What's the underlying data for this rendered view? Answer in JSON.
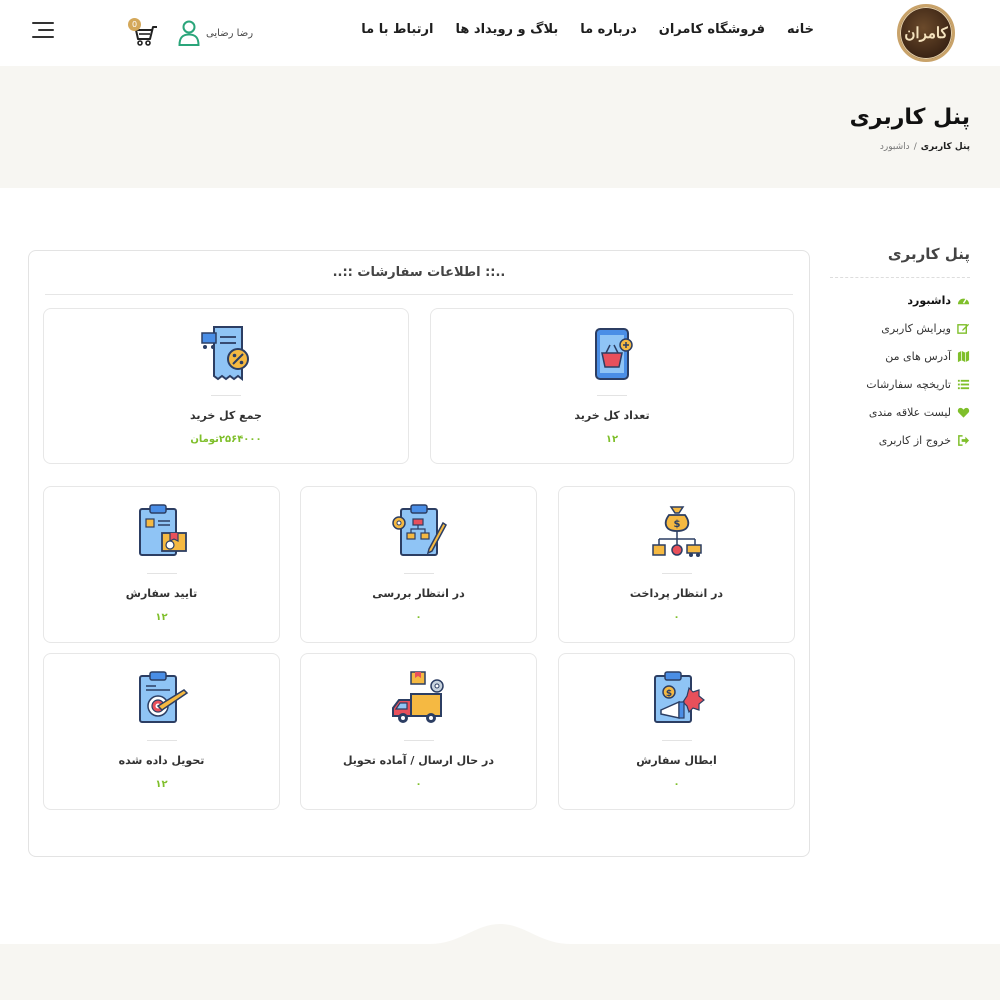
{
  "header": {
    "logo_text": "کامران",
    "nav": [
      "خانه",
      "فروشگاه کامران",
      "درباره ما",
      "بلاگ و رویداد ها",
      "ارتباط با ما"
    ],
    "user_name": "رضا رضایی",
    "cart_count": "0"
  },
  "banner": {
    "title": "پنل کاربری",
    "breadcrumb": {
      "current": "پنل کاربری",
      "separator": "/",
      "page": "داشبورد"
    }
  },
  "sidebar": {
    "title": "پنل کاربری",
    "items": [
      {
        "label": "داشبورد",
        "icon": "dashboard-icon",
        "active": true
      },
      {
        "label": "ویرایش کاربری",
        "icon": "edit-icon",
        "active": false
      },
      {
        "label": "آدرس های من",
        "icon": "map-icon",
        "active": false
      },
      {
        "label": "تاریخچه سفارشات",
        "icon": "list-icon",
        "active": false
      },
      {
        "label": "لیست علاقه مندی",
        "icon": "heart-icon",
        "active": false
      },
      {
        "label": "خروج از کاربری",
        "icon": "sign-out-icon",
        "active": false
      }
    ]
  },
  "panel": {
    "title": "..:: اطلاعات سفارشات ::..",
    "cards": [
      {
        "label": "تعداد کل خرید",
        "value": "۱۲",
        "icon": "shopping-basket-phone-icon"
      },
      {
        "label": "جمع کل خرید",
        "value": "۲۵۶۴۰۰۰تومان",
        "icon": "receipt-discount-icon"
      },
      {
        "label": "در انتظار پرداخت",
        "value": "۰",
        "icon": "money-bag-distribution-icon"
      },
      {
        "label": "در انتظار بررسی",
        "value": "۰",
        "icon": "clipboard-workflow-icon"
      },
      {
        "label": "تایید سفارش",
        "value": "۱۲",
        "icon": "clipboard-package-icon"
      },
      {
        "label": "ابطال سفارش",
        "value": "۰",
        "icon": "clipboard-cancel-megaphone-icon"
      },
      {
        "label": "در حال ارسال / آماده تحویل",
        "value": "۰",
        "icon": "delivery-truck-icon"
      },
      {
        "label": "تحویل داده شده",
        "value": "۱۲",
        "icon": "clipboard-target-icon"
      }
    ]
  },
  "colors": {
    "accent_green": "#7fbf2b",
    "banner_bg": "#f7f6f2",
    "logo_gold": "#c9a36a"
  }
}
